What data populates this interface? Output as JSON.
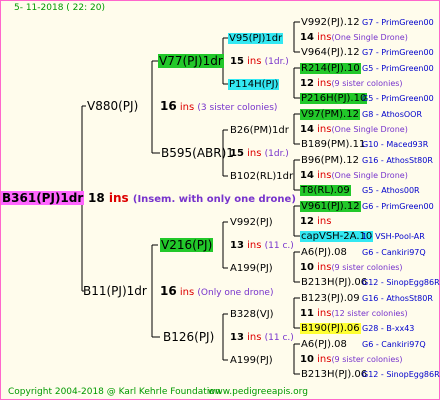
{
  "header": {
    "date": "5- 11-2018 ( 22: 20)"
  },
  "footer": {
    "copyright": "Copyright 2004-2018 @ Karl Kehrle Foundation",
    "url": "www.pedigreeapis.org"
  },
  "colors": {
    "green": "#22C82A",
    "cyan": "#33E8F2",
    "yellow": "#FFFF33",
    "pink": "#FF66FF",
    "line": "#000000"
  },
  "tree": {
    "root": {
      "name": "B361(PJ)1dr",
      "ins": "18",
      "ins_word": "ins",
      "note": "(Insem. with only one drone)"
    },
    "gen1": [
      {
        "name": "V880(PJ)",
        "ins": "16",
        "ins_word": "ins",
        "note": "(3 sister colonies)"
      },
      {
        "name": "B11(PJ)1dr",
        "ins": "16",
        "ins_word": "ins",
        "note": "(Only one drone)"
      }
    ],
    "gen2": [
      {
        "name": "V77(PJ)1dr",
        "ins": "15",
        "ins_word": "ins",
        "note": "(1dr.)"
      },
      {
        "name": "B595(ABR)1",
        "ins": "15",
        "ins_word": "ins",
        "note": "(1dr.)"
      },
      {
        "name": "V216(PJ)",
        "ins": "13",
        "ins_word": "ins",
        "note": "(11 c.)"
      },
      {
        "name": "B126(PJ)",
        "ins": "13",
        "ins_word": "ins",
        "note": "(11 c.)"
      }
    ],
    "gen3": [
      {
        "name": "V95(PJ)1dr"
      },
      {
        "name": "P114H(PJ)"
      },
      {
        "name": "B26(PM)1dr"
      },
      {
        "name": "B102(RL)1dr"
      },
      {
        "name": "V992(PJ)"
      },
      {
        "name": "A199(PJ)"
      },
      {
        "name": "B328(VJ)"
      },
      {
        "name": "A199(PJ)"
      }
    ],
    "gen4": [
      {
        "top": "V992(PJ).12",
        "top_info": "G7 - PrimGreen00",
        "ins": "14",
        "ins_word": "ins",
        "note": "(One Single Drone)",
        "bot": "V964(PJ).12",
        "bot_info": "G7 - PrimGreen00"
      },
      {
        "top": "R214(PJ).10",
        "top_info": "G5 - PrimGreen00",
        "ins": "12",
        "ins_word": "ins",
        "note": "(9 sister colonies)",
        "bot": "P216H(PJ).10",
        "bot_info": "G5 - PrimGreen00"
      },
      {
        "top": "V97(PM).12",
        "top_info": "G8 - AthosOOR",
        "ins": "14",
        "ins_word": "ins",
        "note": "(One Single Drone)",
        "bot": "B189(PM).11",
        "bot_info": "G10 - Maced93R"
      },
      {
        "top": "B96(PM).12",
        "top_info": "G16 - AthosSt80R",
        "ins": "14",
        "ins_word": "ins",
        "note": "(One Single Drone)",
        "bot": "T8(RL).09",
        "bot_info": "G5 - Athos00R"
      },
      {
        "top": "V961(PJ).12",
        "top_info": "G6 - PrimGreen00",
        "ins": "12",
        "ins_word": "ins",
        "note": "",
        "bot": "capVSH-2A.10",
        "bot_info": "1 - VSH-Pool-AR"
      },
      {
        "top": "A6(PJ).08",
        "top_info": "G6 - Cankiri97Q",
        "ins": "10",
        "ins_word": "ins",
        "note": "(9 sister colonies)",
        "bot": "B213H(PJ).06",
        "bot_info": "G12 - SinopEgg86R"
      },
      {
        "top": "B123(PJ).09",
        "top_info": "G16 - AthosSt80R",
        "ins": "11",
        "ins_word": "ins",
        "note": "(12 sister colonies)",
        "bot": "B190(PJ).06",
        "bot_info": "G28 - B-xx43"
      },
      {
        "top": "A6(PJ).08",
        "top_info": "G6 - Cankiri97Q",
        "ins": "10",
        "ins_word": "ins",
        "note": "(9 sister colonies)",
        "bot": "B213H(PJ).06",
        "bot_info": "G12 - SinopEgg86R"
      }
    ]
  }
}
